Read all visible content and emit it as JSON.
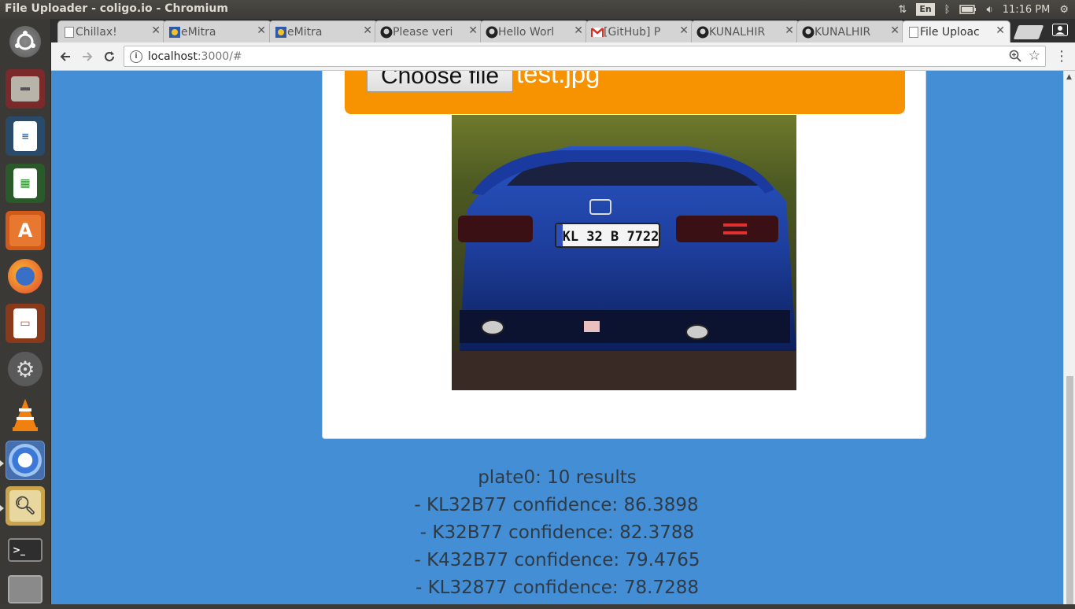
{
  "window": {
    "title": "File Uploader - coligo.io - Chromium"
  },
  "panel": {
    "lang": "En",
    "time": "11:16 PM"
  },
  "tabs": [
    {
      "label": "Chillax!",
      "icon": "doc-icon"
    },
    {
      "label": "eMitra",
      "icon": "emitra-icon"
    },
    {
      "label": "eMitra",
      "icon": "emitra-icon"
    },
    {
      "label": "Please veri",
      "icon": "github-icon"
    },
    {
      "label": "Hello Worl",
      "icon": "github-icon"
    },
    {
      "label": "[GitHub] P",
      "icon": "gmail-icon"
    },
    {
      "label": "KUNALHIR",
      "icon": "github-icon"
    },
    {
      "label": "KUNALHIR",
      "icon": "github-icon"
    },
    {
      "label": "File Uploac",
      "icon": "doc-icon"
    }
  ],
  "address": {
    "host": "localhost",
    "rest": ":3000/#"
  },
  "uploader": {
    "button_label": "Choose file",
    "file_name": "test.jpg"
  },
  "photo": {
    "plate_text": "KL 32 B 7722"
  },
  "results": [
    "plate0: 10 results",
    "- KL32B77 confidence: 86.3898",
    "- K32B77 confidence: 82.3788",
    "- K432B77 confidence: 79.4765",
    "- KL32877 confidence: 78.7288"
  ],
  "colors": {
    "page_bg": "#438ed5",
    "upload_bar": "#f79300",
    "card": "#ffffff"
  }
}
